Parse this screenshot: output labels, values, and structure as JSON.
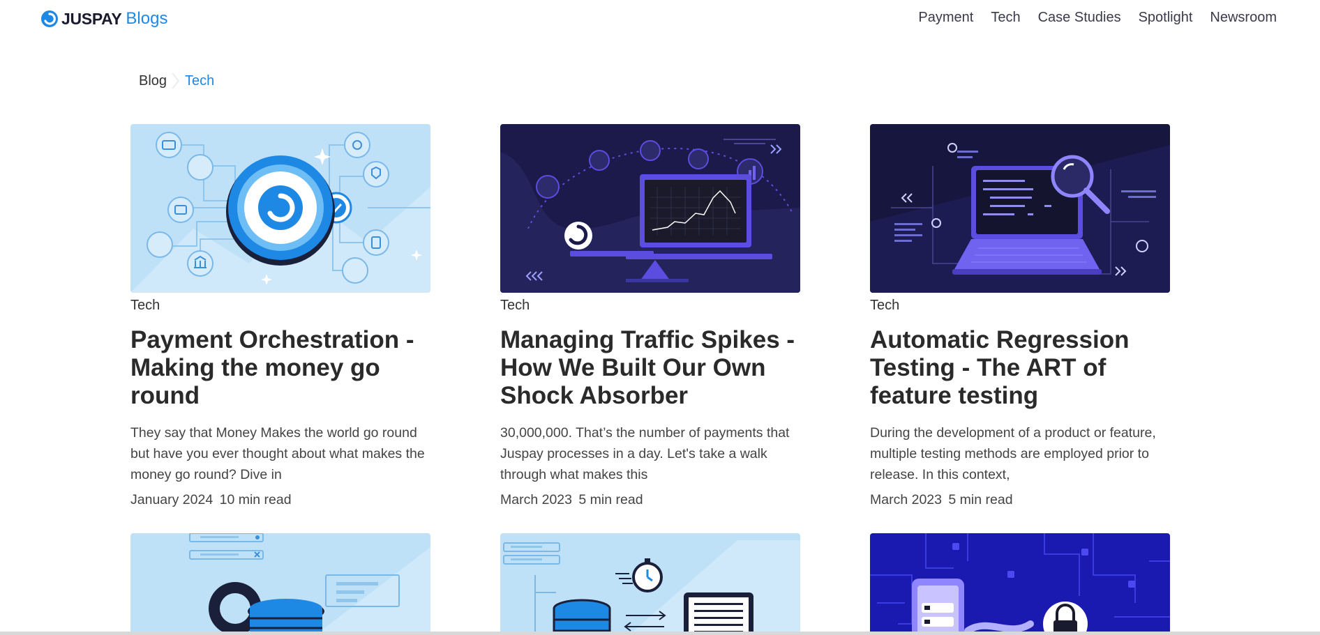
{
  "header": {
    "logo_text": "JUSPAY",
    "logo_suffix": "Blogs",
    "nav": [
      "Payment",
      "Tech",
      "Case Studies",
      "Spotlight",
      "Newsroom"
    ]
  },
  "breadcrumb": {
    "root": "Blog",
    "current": "Tech"
  },
  "cards": [
    {
      "category": "Tech",
      "title": "Payment Orchestration - Making the money go round",
      "excerpt": "They say that Money Makes the world go round but have you ever thought about what makes the money go round? Dive in",
      "date": "January 2024",
      "read_time": "10 min read"
    },
    {
      "category": "Tech",
      "title": "Managing Traffic Spikes - How We Built Our Own Shock Absorber",
      "excerpt": "30,000,000. That’s the number of payments that Juspay processes in a day. Let's take a walk through what makes this",
      "date": "March 2023",
      "read_time": "5 min read"
    },
    {
      "category": "Tech",
      "title": "Automatic Regression Testing - The ART of feature testing",
      "excerpt": "During the development of a product or feature, multiple testing methods are employed prior to release. In this context,",
      "date": "March 2023",
      "read_time": "5 min read"
    }
  ],
  "colors": {
    "brand_blue": "#1e88e5",
    "light_thumb_bg": "#bfe1f7",
    "dark_thumb_bg": "#1c1a4a",
    "accent_purple": "#5b4de0"
  },
  "icons": [
    "juspay-logo-icon",
    "breadcrumb-chevron-icon"
  ]
}
